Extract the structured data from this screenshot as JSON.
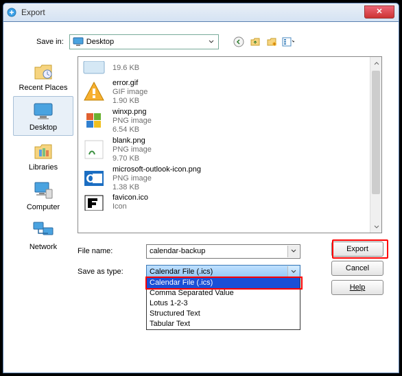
{
  "window": {
    "title": "Export"
  },
  "savein": {
    "label": "Save in:",
    "value": "Desktop"
  },
  "places": [
    {
      "id": "recent",
      "label": "Recent Places"
    },
    {
      "id": "desktop",
      "label": "Desktop"
    },
    {
      "id": "libraries",
      "label": "Libraries"
    },
    {
      "id": "computer",
      "label": "Computer"
    },
    {
      "id": "network",
      "label": "Network"
    }
  ],
  "files": [
    {
      "name": "",
      "type": "",
      "size": "19.6 KB",
      "icon": "generic"
    },
    {
      "name": "error.gif",
      "type": "GIF image",
      "size": "1.90 KB",
      "icon": "warning"
    },
    {
      "name": "winxp.png",
      "type": "PNG image",
      "size": "6.54 KB",
      "icon": "winflag"
    },
    {
      "name": "blank.png",
      "type": "PNG image",
      "size": "9.70 KB",
      "icon": "blank"
    },
    {
      "name": "microsoft-outlook-icon.png",
      "type": "PNG image",
      "size": "1.38 KB",
      "icon": "outlook"
    },
    {
      "name": "favicon.ico",
      "type": "Icon",
      "size": "",
      "icon": "favicon"
    }
  ],
  "filename": {
    "label": "File name:",
    "value": "calendar-backup"
  },
  "saveastype": {
    "label": "Save as type:",
    "value": "Calendar File (.ics)",
    "options": [
      "Calendar File (.ics)",
      "Comma Separated Value",
      "Lotus 1-2-3",
      "Structured Text",
      "Tabular Text"
    ]
  },
  "buttons": {
    "export": "Export",
    "cancel": "Cancel",
    "help": "Help"
  }
}
